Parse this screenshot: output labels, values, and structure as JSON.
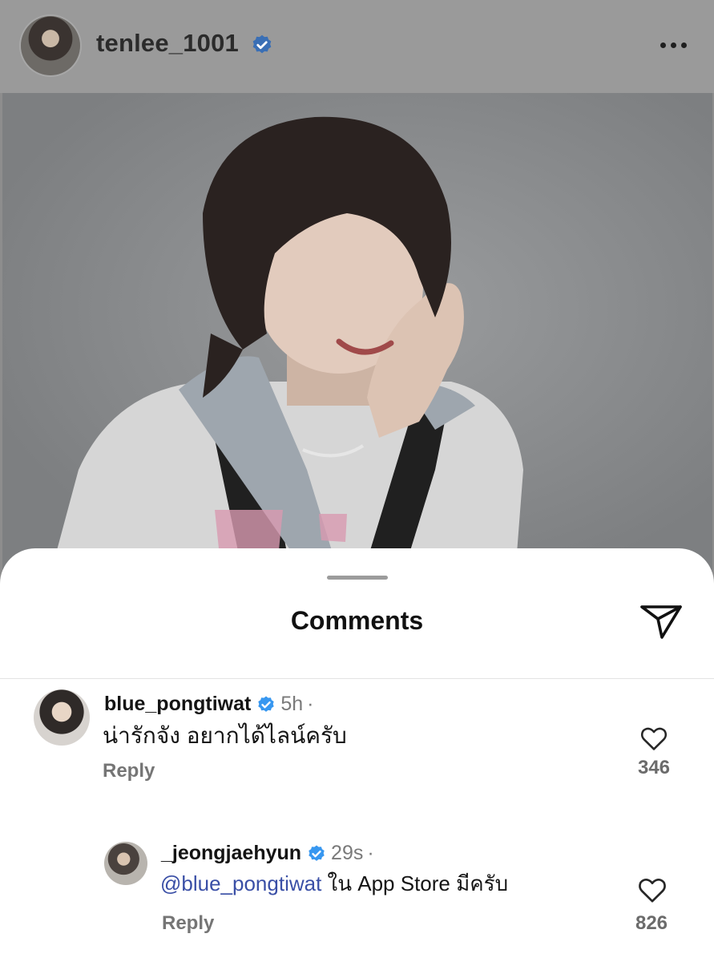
{
  "post": {
    "username": "tenlee_1001",
    "verified": true,
    "more_icon": "more-horizontal-icon"
  },
  "sheet": {
    "title": "Comments",
    "share_icon": "paper-plane-icon"
  },
  "comments": [
    {
      "username": "blue_pongtiwat",
      "verified": true,
      "time": "5h",
      "separator": "·",
      "text": "น่ารักจัง อยากได้ไลน์ครับ",
      "reply_label": "Reply",
      "likes": "346"
    },
    {
      "username": "_jeongjaehyun",
      "verified": true,
      "time": "29s",
      "separator": "·",
      "mention": "@blue_pongtiwat",
      "text": "ใน App Store มีครับ",
      "reply_label": "Reply",
      "likes": "826"
    }
  ],
  "colors": {
    "verified_blue": "#3797f0",
    "mention": "#3a4fa6"
  }
}
